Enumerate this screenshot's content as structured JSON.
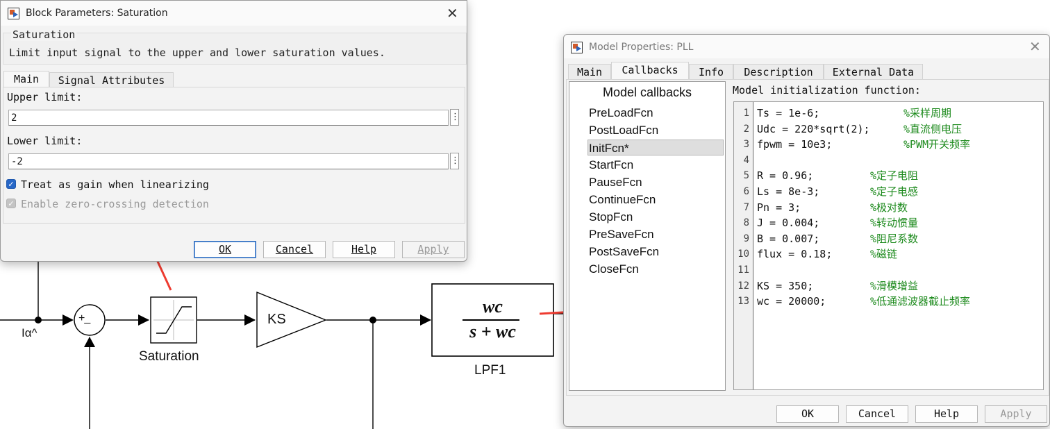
{
  "diagram": {
    "signal_label": "Iα^",
    "sum_sign": "+_",
    "saturation_label": "Saturation",
    "gain_value": "KS",
    "tf_numerator": "wc",
    "tf_denominator": "s + wc",
    "lpf_label": "LPF1"
  },
  "block_params": {
    "title": "Block Parameters: Saturation",
    "block_type": "Saturation",
    "description": "Limit input signal to the upper and lower saturation values.",
    "tabs": [
      "Main",
      "Signal Attributes"
    ],
    "upper_limit_label": "Upper limit:",
    "upper_limit_value": "2",
    "lower_limit_label": "Lower limit:",
    "lower_limit_value": "-2",
    "treat_as_gain": "Treat as gain when linearizing",
    "zero_crossing": "Enable zero-crossing detection",
    "kebab": "⋮",
    "buttons": {
      "ok": "OK",
      "cancel": "Cancel",
      "help": "Help",
      "apply": "Apply"
    }
  },
  "model_props": {
    "title": "Model Properties: PLL",
    "tabs": [
      "Main",
      "Callbacks",
      "Info",
      "Description",
      "External Data"
    ],
    "callbacks_header": "Model callbacks",
    "callbacks": [
      "PreLoadFcn",
      "PostLoadFcn",
      "InitFcn*",
      "StartFcn",
      "PauseFcn",
      "ContinueFcn",
      "StopFcn",
      "PreSaveFcn",
      "PostSaveFcn",
      "CloseFcn"
    ],
    "init_label": "Model initialization function:",
    "code_lines": [
      {
        "n": "1",
        "code": "Ts = 1e-6;",
        "comment": "%采样周期"
      },
      {
        "n": "2",
        "code": "Udc = 220*sqrt(2);",
        "comment": "%直流侧电压"
      },
      {
        "n": "3",
        "code": "fpwm = 10e3;",
        "comment": "%PWM开关频率"
      },
      {
        "n": "4",
        "code": "",
        "comment": ""
      },
      {
        "n": "5",
        "code": "R = 0.96;",
        "comment": "%定子电阻"
      },
      {
        "n": "6",
        "code": "Ls = 8e-3;",
        "comment": "%定子电感"
      },
      {
        "n": "7",
        "code": "Pn = 3;",
        "comment": "%极对数"
      },
      {
        "n": "8",
        "code": "J = 0.004;",
        "comment": "%转动惯量"
      },
      {
        "n": "9",
        "code": "B = 0.007;",
        "comment": "%阻尼系数"
      },
      {
        "n": "10",
        "code": "flux = 0.18;",
        "comment": "%磁链"
      },
      {
        "n": "11",
        "code": "",
        "comment": ""
      },
      {
        "n": "12",
        "code": "KS = 350;",
        "comment": "%滑模增益"
      },
      {
        "n": "13",
        "code": "wc = 20000;",
        "comment": "%低通滤波器截止频率"
      }
    ],
    "buttons": {
      "ok": "OK",
      "cancel": "Cancel",
      "help": "Help",
      "apply": "Apply"
    }
  },
  "colors": {
    "arrow": "#ee3b30",
    "comment": "#1c8a1c",
    "accent": "#2f6dc0"
  }
}
